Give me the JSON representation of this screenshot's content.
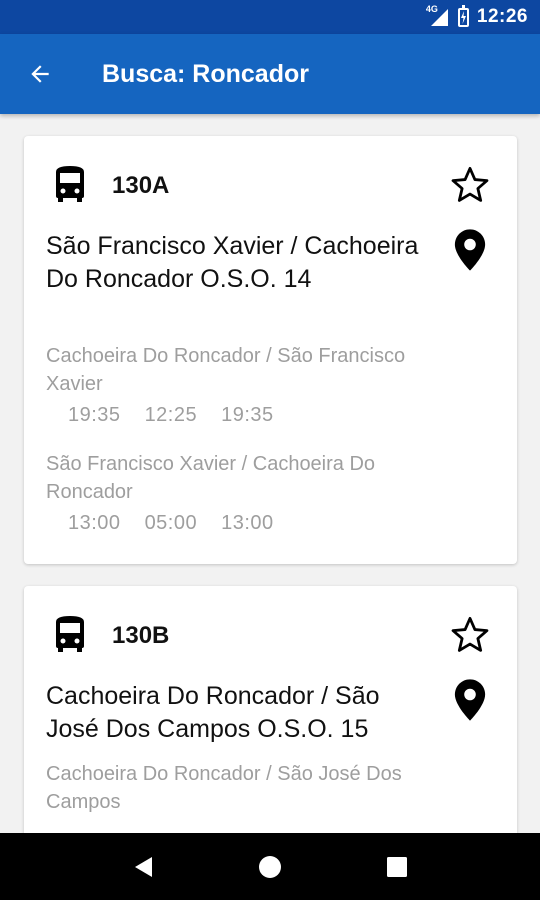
{
  "status_bar": {
    "time": "12:26",
    "network": "4G",
    "icons": [
      "signal-icon",
      "battery-icon"
    ]
  },
  "app_bar": {
    "title": "Busca: Roncador",
    "back_icon": "arrow-back-icon"
  },
  "routes": [
    {
      "code": "130A",
      "name": "São Francisco Xavier / Cachoeira Do Roncador O.S.O. 14",
      "directions": [
        {
          "name": "Cachoeira Do Roncador / São Francisco Xavier",
          "times": [
            "19:35",
            "12:25",
            "19:35"
          ]
        },
        {
          "name": "São Francisco Xavier / Cachoeira Do Roncador",
          "times": [
            "13:00",
            "05:00",
            "13:00"
          ]
        }
      ]
    },
    {
      "code": "130B",
      "name": "Cachoeira Do Roncador / São José Dos Campos O.S.O. 15",
      "directions": [
        {
          "name": "Cachoeira Do Roncador / São José Dos Campos",
          "times": []
        }
      ]
    }
  ],
  "nav_bar": {
    "icons": [
      "back-triangle-icon",
      "home-circle-icon",
      "recents-square-icon"
    ]
  }
}
